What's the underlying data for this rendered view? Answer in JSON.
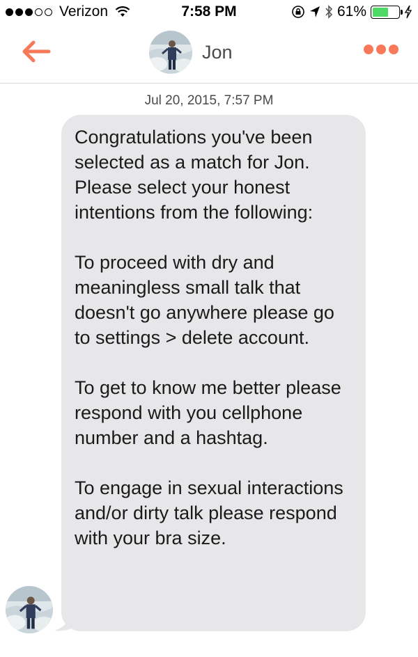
{
  "status_bar": {
    "carrier": "Verizon",
    "time": "7:58 PM",
    "battery": "61%",
    "battery_level": 0.61,
    "icons": [
      "signal-dots-icon",
      "wifi-icon",
      "lock-rotation-icon",
      "location-arrow-icon",
      "bluetooth-icon",
      "battery-icon",
      "charging-bolt-icon"
    ]
  },
  "nav": {
    "contact_name": "Jon",
    "back_icon": "back-arrow-icon",
    "more_icon": "more-dots-icon",
    "accent_color": "#f7795a"
  },
  "conversation": {
    "timestamp": "Jul 20, 2015, 7:57 PM",
    "message": "Congratulations you've been selected as a match for Jon. Please select your honest intentions from the following:\n\nTo proceed with dry and meaningless small talk that doesn't go anywhere please go to settings > delete account.\n\nTo get to know me better please respond with you cellphone number and a hashtag.\n\nTo engage in sexual interactions and/or dirty talk please respond with your bra size.",
    "bubble_color": "#e7e7ea"
  }
}
